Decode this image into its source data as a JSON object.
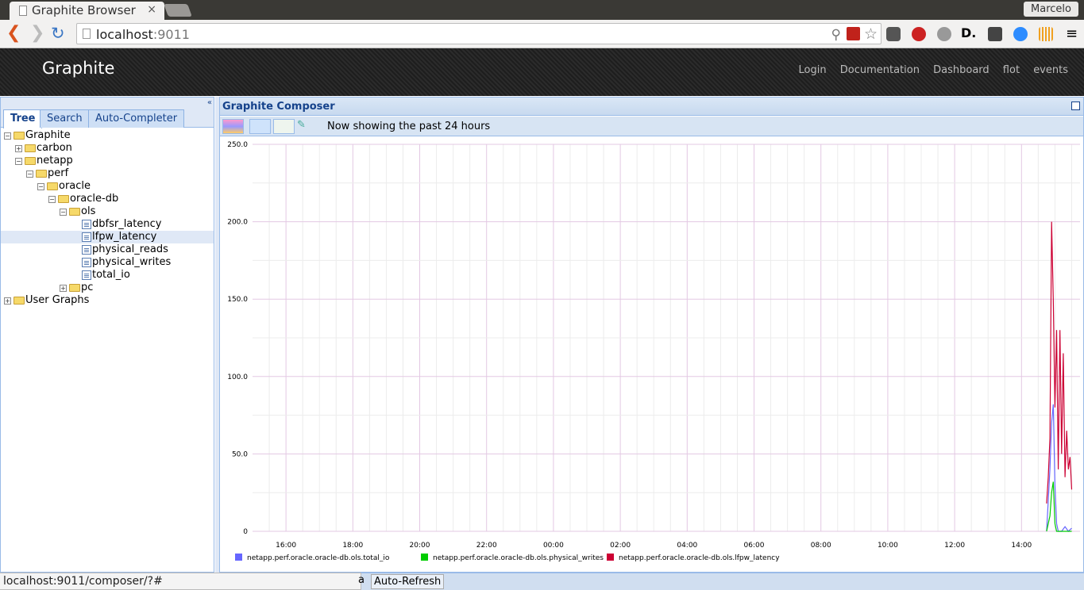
{
  "browser": {
    "tab_title": "Graphite Browser",
    "tab_close": "×",
    "user": "Marcelo",
    "url_host": "localhost",
    "url_port": ":9011",
    "status_url": "localhost:9011/composer/?#"
  },
  "header": {
    "brand": "Graphite",
    "nav": [
      "Login",
      "Documentation",
      "Dashboard",
      "flot",
      "events"
    ]
  },
  "sidebar": {
    "tabs": [
      "Tree",
      "Search",
      "Auto-Completer"
    ],
    "tree": [
      {
        "label": "Graphite",
        "depth": 0,
        "type": "folder",
        "expanded": true
      },
      {
        "label": "carbon",
        "depth": 1,
        "type": "folder",
        "expanded": false
      },
      {
        "label": "netapp",
        "depth": 1,
        "type": "folder",
        "expanded": true
      },
      {
        "label": "perf",
        "depth": 2,
        "type": "folder",
        "expanded": true
      },
      {
        "label": "oracle",
        "depth": 3,
        "type": "folder",
        "expanded": true
      },
      {
        "label": "oracle-db",
        "depth": 4,
        "type": "folder",
        "expanded": true
      },
      {
        "label": "ols",
        "depth": 5,
        "type": "folder",
        "expanded": true
      },
      {
        "label": "dbfsr_latency",
        "depth": 6,
        "type": "leaf"
      },
      {
        "label": "lfpw_latency",
        "depth": 6,
        "type": "leaf",
        "selected": true
      },
      {
        "label": "physical_reads",
        "depth": 6,
        "type": "leaf"
      },
      {
        "label": "physical_writes",
        "depth": 6,
        "type": "leaf"
      },
      {
        "label": "total_io",
        "depth": 6,
        "type": "leaf"
      },
      {
        "label": "pc",
        "depth": 5,
        "type": "folder",
        "expanded": false
      },
      {
        "label": "User Graphs",
        "depth": 0,
        "type": "folder",
        "expanded": false
      }
    ]
  },
  "composer": {
    "title": "Graphite Composer",
    "status": "Now showing the past 24 hours",
    "auto_refresh": "Auto-Refresh",
    "hidden_fragment": "a"
  },
  "chart_data": {
    "type": "line",
    "ylim": [
      0,
      250
    ],
    "yticks": [
      "0",
      "50.0",
      "100.0",
      "150.0",
      "200.0",
      "250.0"
    ],
    "xticks": [
      "16:00",
      "18:00",
      "20:00",
      "22:00",
      "00:00",
      "02:00",
      "04:00",
      "06:00",
      "08:00",
      "10:00",
      "12:00",
      "14:00"
    ],
    "xrange_hours": [
      15.0,
      39.75
    ],
    "series": [
      {
        "name": "netapp.perf.oracle.oracle-db.ols.total_io",
        "color": "#6666ff",
        "x": [
          38.75,
          38.8,
          38.85,
          38.9,
          38.95,
          39.0,
          39.05,
          39.1,
          39.2,
          39.3,
          39.4,
          39.5
        ],
        "y": [
          0,
          20,
          40,
          70,
          82,
          30,
          5,
          0,
          0,
          3,
          0,
          2
        ]
      },
      {
        "name": "netapp.perf.oracle.oracle-db.ols.physical_writes",
        "color": "#00cc00",
        "x": [
          38.75,
          38.85,
          38.9,
          38.95,
          39.0,
          39.05,
          39.1,
          39.2,
          39.3,
          39.4,
          39.5
        ],
        "y": [
          0,
          10,
          25,
          32,
          5,
          0,
          0,
          0,
          0,
          0,
          0
        ]
      },
      {
        "name": "netapp.perf.oracle.oracle-db.ols.lfpw_latency",
        "color": "#cc0033",
        "x": [
          38.75,
          38.8,
          38.85,
          38.9,
          38.95,
          39.0,
          39.05,
          39.1,
          39.15,
          39.2,
          39.25,
          39.3,
          39.35,
          39.4,
          39.45,
          39.5
        ],
        "y": [
          18,
          35,
          60,
          200,
          150,
          80,
          130,
          40,
          130,
          50,
          115,
          35,
          65,
          40,
          48,
          27
        ]
      }
    ]
  }
}
